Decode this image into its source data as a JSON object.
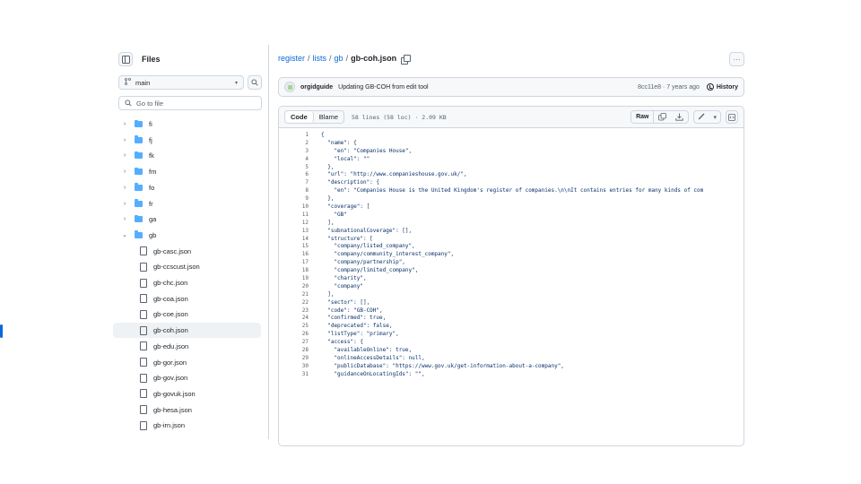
{
  "sidebar": {
    "title": "Files",
    "branch": "main",
    "goto_placeholder": "Go to file",
    "folders": [
      {
        "label": "fi"
      },
      {
        "label": "fj"
      },
      {
        "label": "fk"
      },
      {
        "label": "fm"
      },
      {
        "label": "fo"
      },
      {
        "label": "fr"
      },
      {
        "label": "ga"
      },
      {
        "label": "gb"
      }
    ],
    "files": [
      {
        "label": "gb-casc.json"
      },
      {
        "label": "gb-ccscust.json"
      },
      {
        "label": "gb-chc.json"
      },
      {
        "label": "gb-coa.json"
      },
      {
        "label": "gb-coe.json"
      },
      {
        "label": "gb-coh.json"
      },
      {
        "label": "gb-edu.json"
      },
      {
        "label": "gb-gor.json"
      },
      {
        "label": "gb-gov.json"
      },
      {
        "label": "gb-govuk.json"
      },
      {
        "label": "gb-hesa.json"
      },
      {
        "label": "gb-irn.json"
      }
    ]
  },
  "breadcrumb": {
    "repo": "register",
    "sep1": "/",
    "dir1": "lists",
    "sep2": "/",
    "dir2": "gb",
    "sep3": "/",
    "file": "gb-coh.json"
  },
  "commit": {
    "user": "orgidguide",
    "message": "Updating GB-COH from edit tool",
    "meta": "8cc11e8 · 7 years ago",
    "history_label": "History"
  },
  "file_bar": {
    "code_tab": "Code",
    "blame_tab": "Blame",
    "meta": "58 lines (58 loc) · 2.09 KB",
    "raw_label": "Raw"
  },
  "code_lines": [
    {
      "n": "1",
      "t": "{"
    },
    {
      "n": "2",
      "t": "  \"name\": {"
    },
    {
      "n": "3",
      "t": "    \"en\": \"Companies House\","
    },
    {
      "n": "4",
      "t": "    \"local\": \"\""
    },
    {
      "n": "5",
      "t": "  },"
    },
    {
      "n": "6",
      "t": "  \"url\": \"http://www.companieshouse.gov.uk/\","
    },
    {
      "n": "7",
      "t": "  \"description\": {"
    },
    {
      "n": "8",
      "t": "    \"en\": \"Companies House is the United Kingdom's register of companies.\\n\\nIt contains entries for many kinds of com"
    },
    {
      "n": "9",
      "t": "  },"
    },
    {
      "n": "10",
      "t": "  \"coverage\": ["
    },
    {
      "n": "11",
      "t": "    \"GB\""
    },
    {
      "n": "12",
      "t": "  ],"
    },
    {
      "n": "13",
      "t": "  \"subnationalCoverage\": [],"
    },
    {
      "n": "14",
      "t": "  \"structure\": ["
    },
    {
      "n": "15",
      "t": "    \"company/listed_company\","
    },
    {
      "n": "16",
      "t": "    \"company/community_interest_company\","
    },
    {
      "n": "17",
      "t": "    \"company/partnership\","
    },
    {
      "n": "18",
      "t": "    \"company/limited_company\","
    },
    {
      "n": "19",
      "t": "    \"charity\","
    },
    {
      "n": "20",
      "t": "    \"company\""
    },
    {
      "n": "21",
      "t": "  ],"
    },
    {
      "n": "22",
      "t": "  \"sector\": [],"
    },
    {
      "n": "23",
      "t": "  \"code\": \"GB-COH\","
    },
    {
      "n": "24",
      "t": "  \"confirmed\": true,"
    },
    {
      "n": "25",
      "t": "  \"deprecated\": false,"
    },
    {
      "n": "26",
      "t": "  \"listType\": \"primary\","
    },
    {
      "n": "27",
      "t": "  \"access\": {"
    },
    {
      "n": "28",
      "t": "    \"availableOnline\": true,"
    },
    {
      "n": "29",
      "t": "    \"onlineAccessDetails\": null,"
    },
    {
      "n": "30",
      "t": "    \"publicDatabase\": \"https://www.gov.uk/get-information-about-a-company\","
    },
    {
      "n": "31",
      "t": "    \"guidanceOnLocatingIds\": \"\","
    }
  ],
  "icons": {
    "sidebar_toggle": "sidebar-collapse-icon",
    "branch": "git-branch-icon",
    "search": "search-icon",
    "copy": "copy-icon",
    "history": "clock-icon",
    "download": "download-icon",
    "edit": "pencil-icon",
    "symbols": "code-symbols-icon",
    "more": "kebab-horizontal-icon"
  }
}
